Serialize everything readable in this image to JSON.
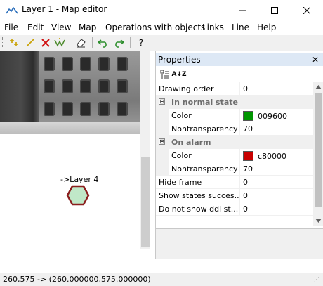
{
  "window": {
    "title": "Layer 1 - Map editor",
    "icon": "mountains-icon",
    "buttons": {
      "minimize": "minimize-icon",
      "maximize": "maximize-icon",
      "close": "close-icon"
    }
  },
  "menu": [
    "File",
    "Edit",
    "View",
    "Map",
    "Operations with objects",
    "Links",
    "Line",
    "Help"
  ],
  "toolbar": {
    "icons": [
      "add-points-icon",
      "draw-line-icon",
      "delete-icon",
      "edit-vertices-icon",
      "eraser-icon",
      "undo-icon",
      "redo-icon",
      "help-icon"
    ],
    "help_label": "?"
  },
  "canvas": {
    "layer_label": "->Layer 4",
    "hexagon": {
      "fill": "#c0e8c8",
      "stroke": "#8b1e1e"
    }
  },
  "properties": {
    "title": "Properties",
    "close": "✕",
    "sort_label": "A↓Z",
    "rows": [
      {
        "type": "prop",
        "name": "Drawing order",
        "value": "0"
      },
      {
        "type": "category",
        "name": "In normal state",
        "expander": "⊟"
      },
      {
        "type": "prop",
        "indent": true,
        "name": "Color",
        "value": "009600",
        "swatch": "#009600"
      },
      {
        "type": "prop",
        "indent": true,
        "name": "Nontransparency",
        "value": "70"
      },
      {
        "type": "category",
        "name": "On alarm",
        "expander": "⊟"
      },
      {
        "type": "prop",
        "indent": true,
        "name": "Color",
        "value": "c80000",
        "swatch": "#c80000"
      },
      {
        "type": "prop",
        "indent": true,
        "name": "Nontransparency",
        "value": "70"
      },
      {
        "type": "prop",
        "name": "Hide frame",
        "value": "0"
      },
      {
        "type": "prop",
        "name": "Show states succes...",
        "value": "0"
      },
      {
        "type": "prop",
        "name": "Do not show ddi st...",
        "value": "0"
      }
    ]
  },
  "status": {
    "coordinates": "260,575 -> (260.000000,575.000000)"
  }
}
